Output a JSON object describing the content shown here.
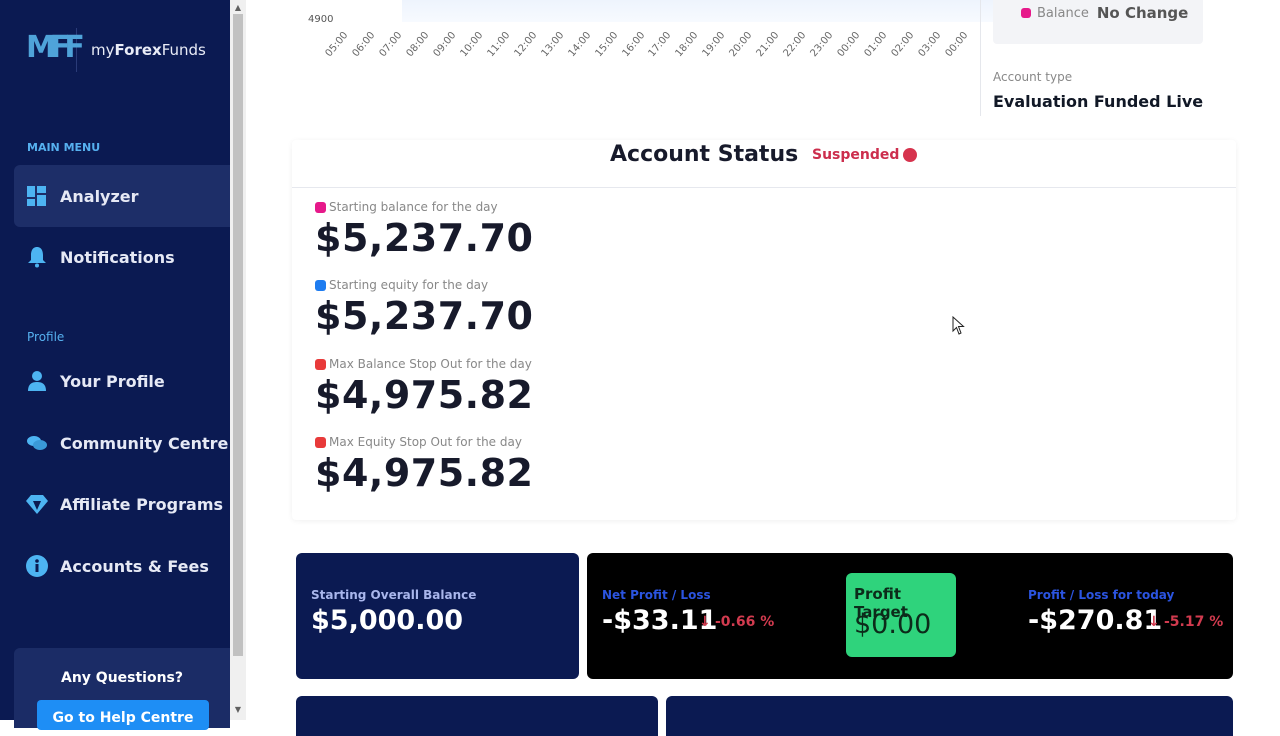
{
  "sidebar": {
    "brand": {
      "mark": "MFF",
      "name_prefix": "my",
      "name_bold": "Forex",
      "name_suffix": "Funds"
    },
    "main_menu_heading": "MAIN MENU",
    "main_items": [
      {
        "label": "Analyzer",
        "icon": "dashboard-icon",
        "active": true
      },
      {
        "label": "Notifications",
        "icon": "bell-icon",
        "active": false
      }
    ],
    "profile_heading": "Profile",
    "profile_items": [
      {
        "label": "Your Profile",
        "icon": "user-icon"
      },
      {
        "label": "Community Centre",
        "icon": "chat-icon"
      },
      {
        "label": "Affiliate Programs",
        "icon": "diamond-icon"
      },
      {
        "label": "Accounts & Fees",
        "icon": "info-icon"
      }
    ],
    "help": {
      "title": "Any Questions?",
      "button": "Go to Help Centre"
    }
  },
  "chart_data": {
    "type": "area",
    "y_ticks": [
      "4900"
    ],
    "x_ticks": [
      "05:00",
      "06:00",
      "07:00",
      "08:00",
      "09:00",
      "10:00",
      "11:00",
      "12:00",
      "13:00",
      "14:00",
      "15:00",
      "16:00",
      "17:00",
      "18:00",
      "19:00",
      "20:00",
      "21:00",
      "22:00",
      "23:00",
      "00:00",
      "01:00",
      "02:00",
      "03:00",
      "00:00"
    ]
  },
  "legend": {
    "series": "Balance",
    "value": "No Change",
    "color": "#e6198a"
  },
  "account_type": {
    "label": "Account type",
    "value": "Evaluation Funded Live"
  },
  "account_status": {
    "title": "Account Status",
    "status": "Suspended",
    "status_color": "#d6334d",
    "stats": [
      {
        "label": "Starting balance for the day",
        "value": "$5,237.70",
        "color": "#e6198a"
      },
      {
        "label": "Starting equity for the day",
        "value": "$5,237.70",
        "color": "#1e7cf0"
      },
      {
        "label": "Max Balance Stop Out for the day",
        "value": "$4,975.82",
        "color": "#e83a3a"
      },
      {
        "label": "Max Equity Stop Out for the day",
        "value": "$4,975.82",
        "color": "#e83a3a"
      }
    ]
  },
  "kpis": {
    "starting_overall": {
      "label": "Starting Overall Balance",
      "value": "$5,000.00"
    },
    "net_pl": {
      "label": "Net Profit / Loss",
      "value": "-$33.11",
      "arrow": "↓",
      "delta": "-0.66 %"
    },
    "profit_target": {
      "label": "Profit Target",
      "value": "$0.00"
    },
    "today_pl": {
      "label": "Profit / Loss for today",
      "value": "-$270.81",
      "arrow": "↓",
      "delta": "-5.17 %"
    }
  }
}
